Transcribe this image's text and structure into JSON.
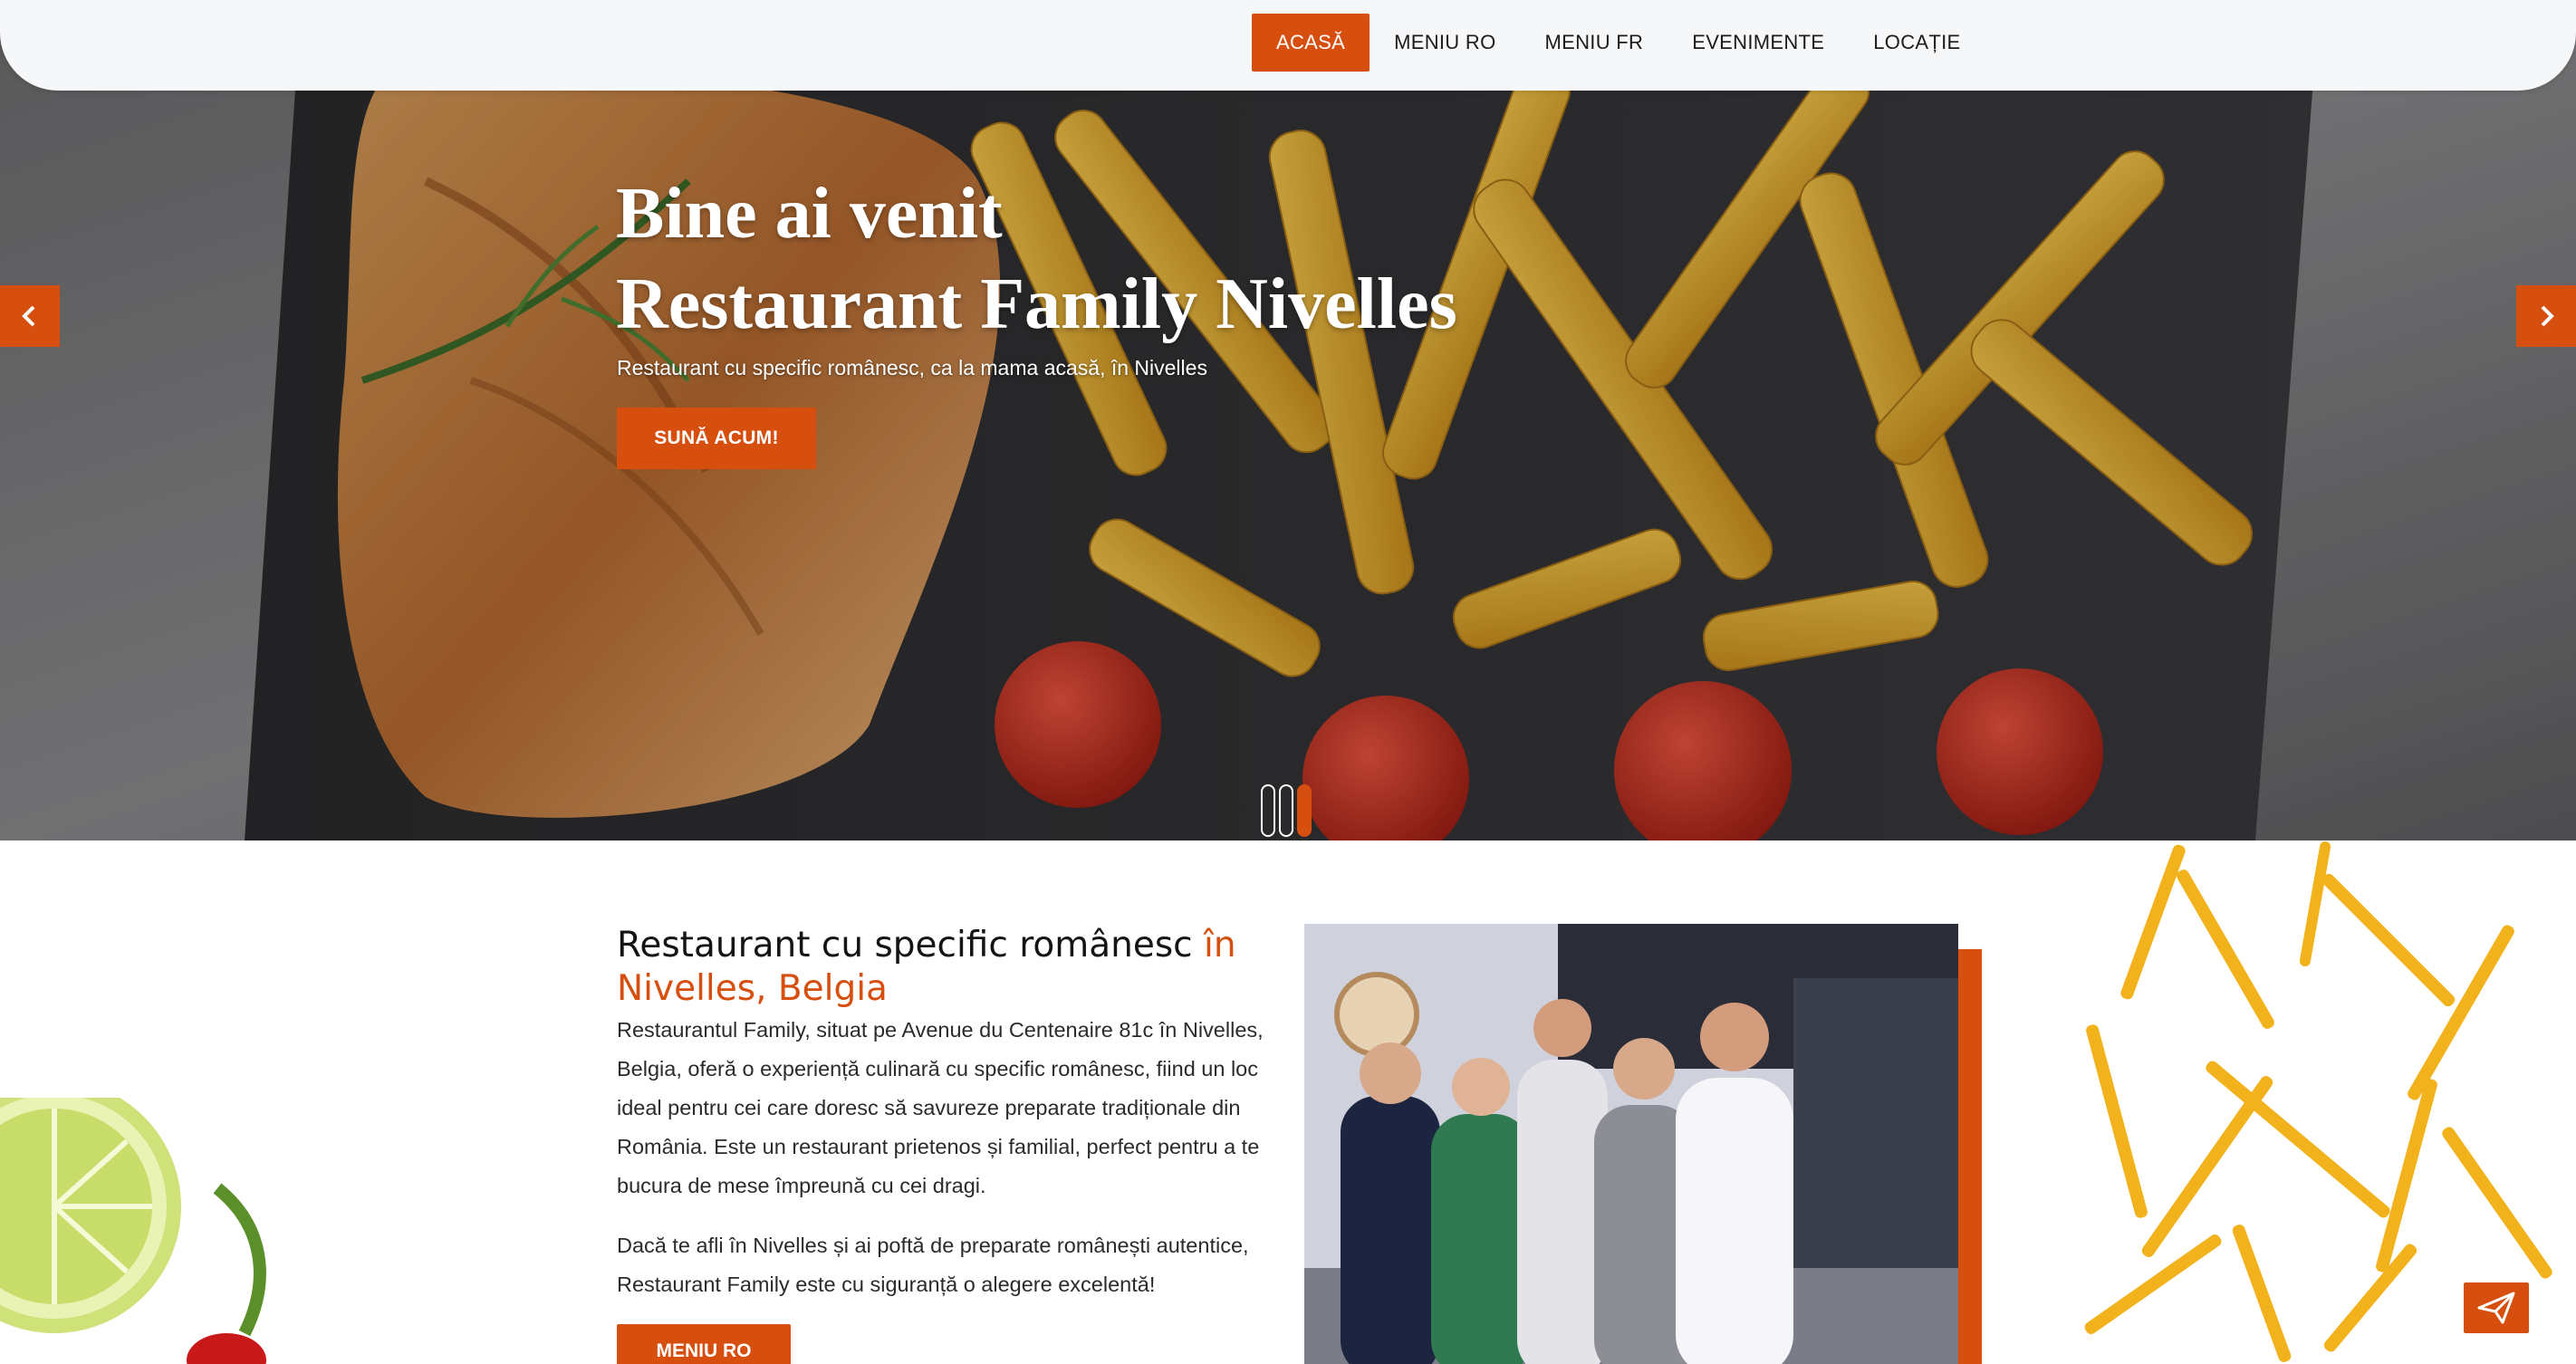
{
  "nav": {
    "items": [
      {
        "label": "ACASĂ",
        "active": true
      },
      {
        "label": "MENIU RO",
        "active": false
      },
      {
        "label": "MENIU FR",
        "active": false
      },
      {
        "label": "EVENIMENTE",
        "active": false
      },
      {
        "label": "LOCAȚIE",
        "active": false
      }
    ]
  },
  "hero": {
    "title_line1": "Bine ai venit",
    "title_line2": "Restaurant Family Nivelles",
    "subtitle": "Restaurant cu specific românesc, ca la mama acasă, în Nivelles",
    "cta_label": "SUNĂ ACUM!",
    "slides_total": 3,
    "active_slide": 3,
    "prev_icon": "chevron-left-icon",
    "next_icon": "chevron-right-icon"
  },
  "about": {
    "title_main": "Restaurant cu specific românesc ",
    "title_accent": "în Nivelles, Belgia",
    "paragraph1": "Restaurantul Family, situat pe Avenue du Centenaire 81c în Nivelles, Belgia, oferă o experiență culinară cu specific românesc, fiind un loc ideal pentru cei care doresc să savureze preparate tradiționale din România. Este un restaurant prietenos și familial, perfect pentru a te bucura de mese împreună cu cei dragi.",
    "paragraph2": "Dacă te afli în Nivelles și ai poftă de preparate românești autentice, Restaurant Family este cu siguranță o alegere excelentă!",
    "menu_button": "MENIU RO"
  },
  "floating": {
    "send_icon": "paper-plane-icon"
  },
  "colors": {
    "accent": "#d64f0f",
    "nav_bg": "#f6f7f9",
    "text": "#141414"
  }
}
